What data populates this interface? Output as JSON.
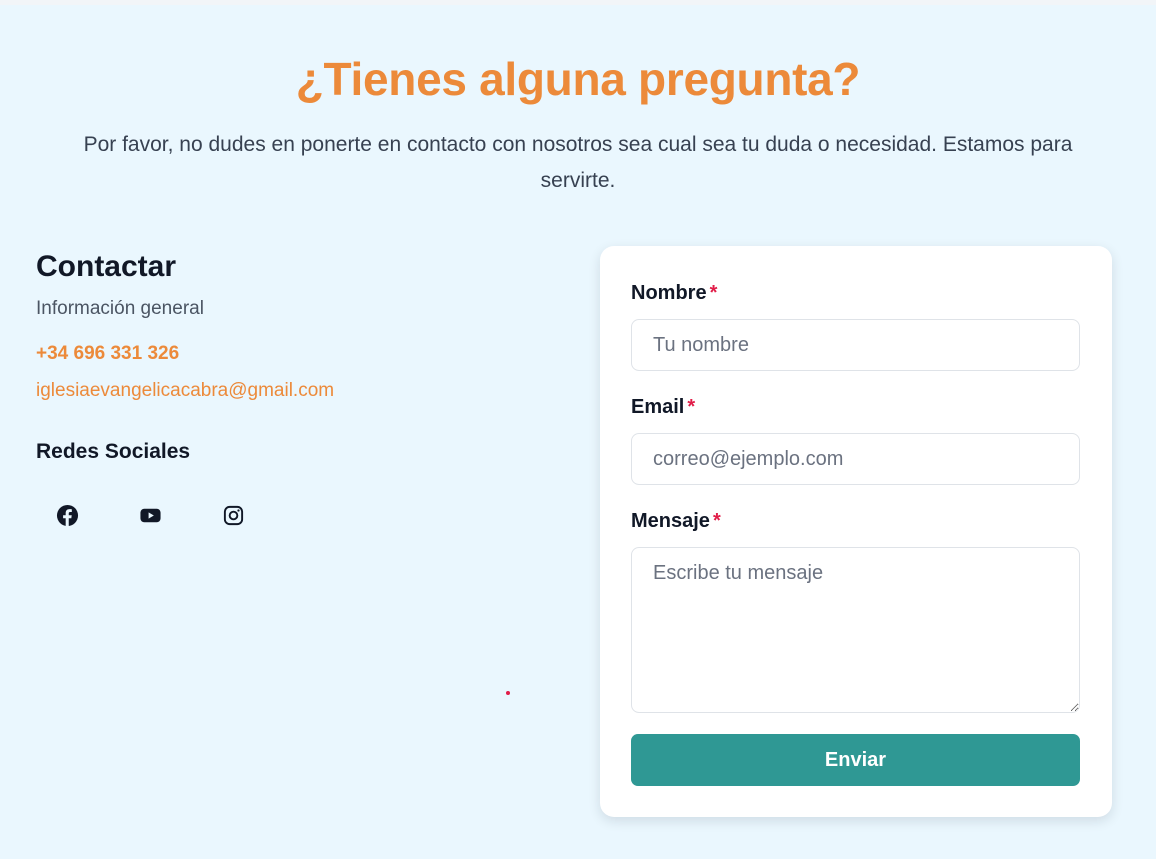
{
  "header": {
    "title": "¿Tienes alguna pregunta?",
    "intro": "Por favor, no dudes en ponerte en contacto con nosotros sea cual sea tu duda o necesidad. Estamos para servirte."
  },
  "contact": {
    "title": "Contactar",
    "subtitle": "Información general",
    "phone": "+34 696 331 326",
    "email": "iglesiaevangelicacabra@gmail.com"
  },
  "social": {
    "title": "Redes Sociales",
    "icons": [
      "facebook-icon",
      "youtube-icon",
      "instagram-icon"
    ]
  },
  "form": {
    "name_label": "Nombre",
    "name_placeholder": "Tu nombre",
    "email_label": "Email",
    "email_placeholder": "correo@ejemplo.com",
    "message_label": "Mensaje",
    "message_placeholder": "Escribe tu mensaje",
    "required_marker": "*",
    "submit_label": "Enviar"
  },
  "colors": {
    "accent": "#ec8a3a",
    "button": "#2f9894",
    "background": "#eaf7fe",
    "required": "#e11d48"
  }
}
